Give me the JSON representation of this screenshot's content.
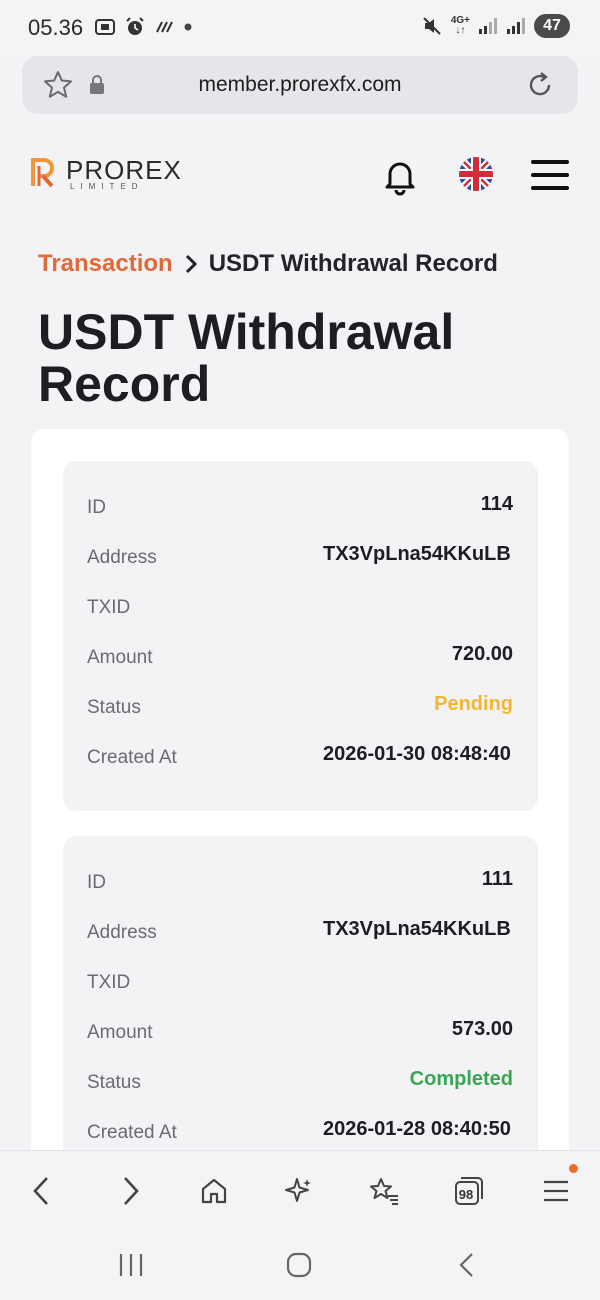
{
  "status_bar": {
    "time": "05.36",
    "network": "4G+",
    "battery": "47"
  },
  "browser": {
    "url": "member.prorexfx.com",
    "tab_count": "98"
  },
  "site": {
    "logo_name": "PROREX",
    "logo_sub": "LIMITED"
  },
  "breadcrumb": {
    "parent": "Transaction",
    "current": "USDT Withdrawal Record"
  },
  "page_title": "USDT Withdrawal Record",
  "labels": {
    "id": "ID",
    "address": "Address",
    "txid": "TXID",
    "amount": "Amount",
    "status": "Status",
    "created_at": "Created At"
  },
  "records": [
    {
      "id": "114",
      "address": "TX3VpLna54KKuLB",
      "txid": "",
      "amount": "720.00",
      "status": "Pending",
      "created_at": "2026-01-30 08:48:40"
    },
    {
      "id": "111",
      "address": "TX3VpLna54KKuLB",
      "txid": "",
      "amount": "573.00",
      "status": "Completed",
      "created_at": "2026-01-28 08:40:50"
    }
  ],
  "colors": {
    "accent": "#e0693a",
    "pending": "#f2b731",
    "completed": "#3aa654"
  }
}
